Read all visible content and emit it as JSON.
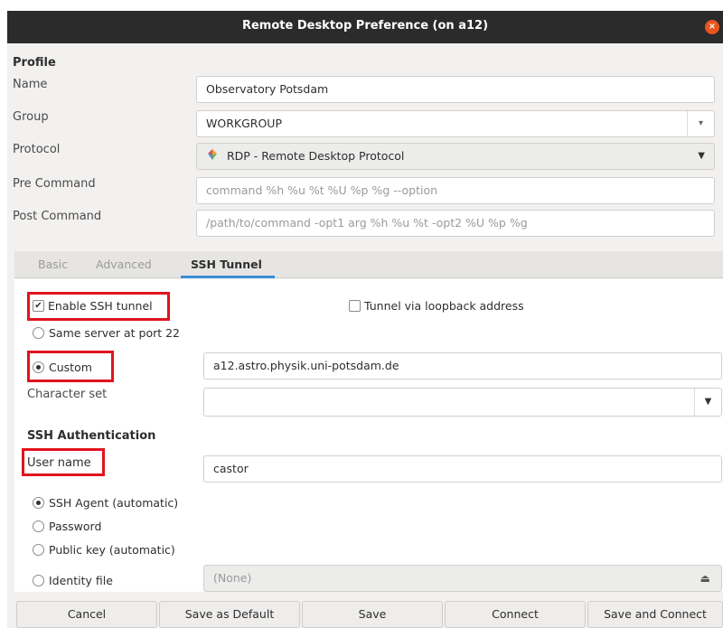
{
  "window": {
    "title": "Remote Desktop Preference (on a12)",
    "close_glyph": "×"
  },
  "profile": {
    "section_label": "Profile",
    "name_label": "Name",
    "name_value": "Observatory Potsdam",
    "group_label": "Group",
    "group_value": "WORKGROUP",
    "protocol_label": "Protocol",
    "protocol_value": "RDP - Remote Desktop Protocol",
    "pre_command_label": "Pre Command",
    "pre_command_placeholder": "command %h %u %t %U %p %g --option",
    "post_command_label": "Post Command",
    "post_command_placeholder": "/path/to/command -opt1 arg %h %u %t -opt2 %U %p %g"
  },
  "tabs": [
    "Basic",
    "Advanced",
    "SSH Tunnel"
  ],
  "active_tab": "SSH Tunnel",
  "ssh": {
    "enable_label": "Enable SSH tunnel",
    "enable_checked": true,
    "loopback_label": "Tunnel via loopback address",
    "loopback_checked": false,
    "same_server_label": "Same server at port 22",
    "custom_label": "Custom",
    "custom_selected": true,
    "custom_value": "a12.astro.physik.uni-potsdam.de",
    "charset_label": "Character set",
    "charset_value": "",
    "auth_section_label": "SSH Authentication",
    "username_label": "User name",
    "username_value": "castor",
    "auth_options": [
      "SSH Agent (automatic)",
      "Password",
      "Public key (automatic)",
      "Identity file"
    ],
    "auth_selected": "SSH Agent (automatic)",
    "identity_file_value": "(None)"
  },
  "buttons": {
    "cancel": "Cancel",
    "save_default": "Save as Default",
    "save": "Save",
    "connect": "Connect",
    "save_connect": "Save and Connect"
  },
  "colors": {
    "accent": "#3d8ad6",
    "highlight_box": "#e0141e",
    "titlebar": "#2b2b2b",
    "close": "#e95420"
  },
  "icons": {
    "protocol_icon": "rdp-protocol-icon",
    "file_chooser_icon": "file-open-icon"
  }
}
